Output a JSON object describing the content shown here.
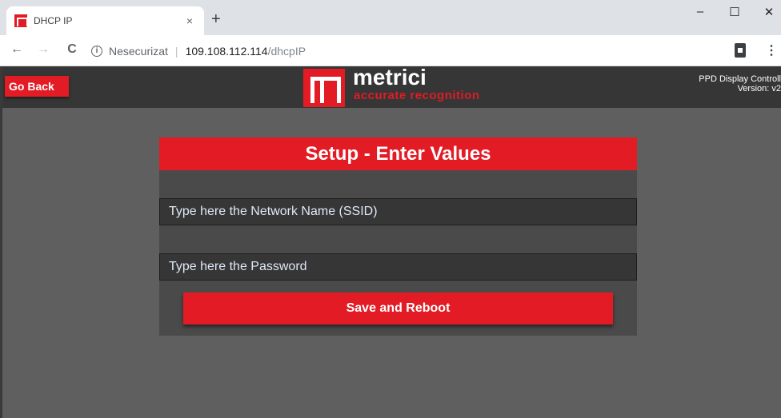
{
  "browser": {
    "tab": {
      "title": "DHCP IP",
      "close_glyph": "×"
    },
    "new_tab_glyph": "+",
    "window": {
      "minimize": "–",
      "maximize": "☐",
      "close": "✕"
    },
    "nav": {
      "back": "←",
      "forward": "→",
      "reload": "C"
    },
    "address": {
      "security_label": "Nesecurizat",
      "host": "109.108.112.114",
      "path": "/dhcpIP"
    },
    "menu_glyph": "⋮"
  },
  "app": {
    "go_back_label": "Go Back",
    "logo": {
      "name": "metrici",
      "tagline": "accurate recognition"
    },
    "controller": {
      "line1": "PPD Display Controll",
      "line2": "Version: v2"
    },
    "form": {
      "title": "Setup - Enter Values",
      "ssid_placeholder": "Type here the Network Name (SSID)",
      "password_placeholder": "Type here the Password",
      "submit_label": "Save and Reboot"
    }
  },
  "colors": {
    "accent": "#e21b24",
    "page_bg": "#5f5f5f",
    "header_bg": "#363636"
  }
}
